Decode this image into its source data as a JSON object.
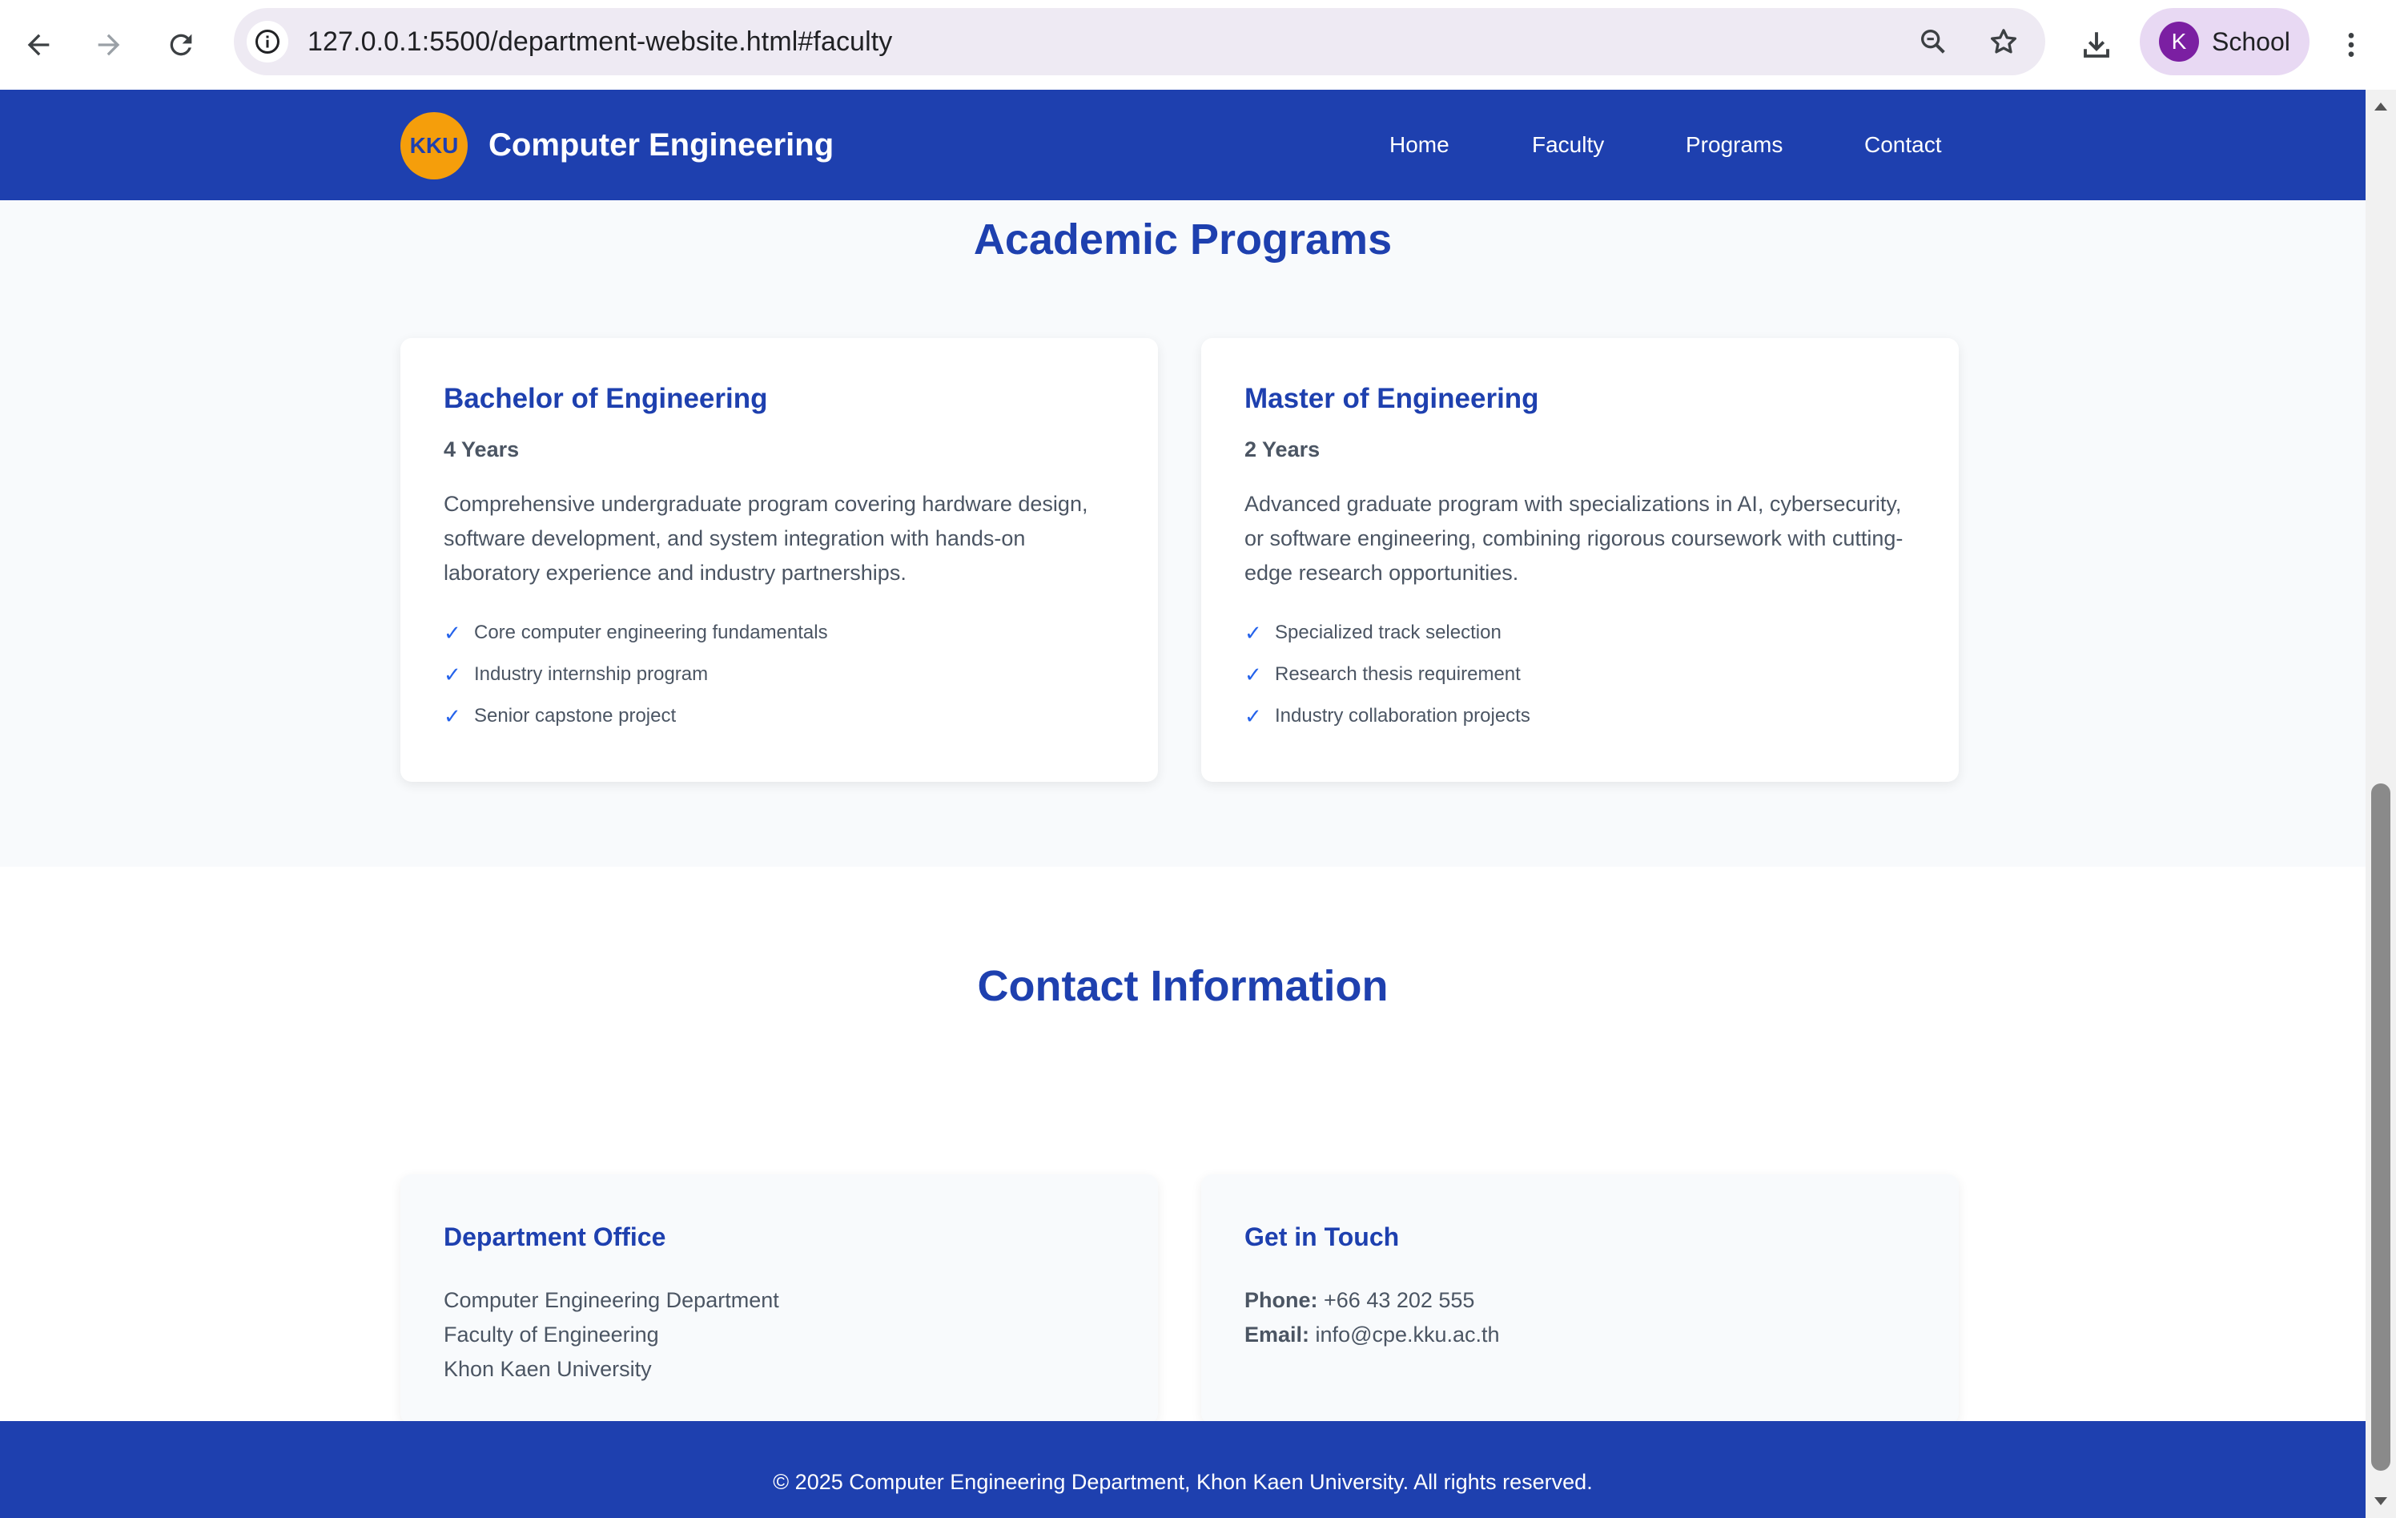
{
  "browser": {
    "url": "127.0.0.1:5500/department-website.html#faculty",
    "profile_initial": "K",
    "profile_name": "School"
  },
  "site": {
    "logo_text": "KKU",
    "title": "Computer Engineering",
    "nav": [
      "Home",
      "Faculty",
      "Programs",
      "Contact"
    ]
  },
  "programs": {
    "title": "Academic Programs",
    "cards": [
      {
        "title": "Bachelor of Engineering",
        "duration": "4 Years",
        "description": "Comprehensive undergraduate program covering hardware design, software development, and system integration with hands-on laboratory experience and industry partnerships.",
        "features": [
          "Core computer engineering fundamentals",
          "Industry internship program",
          "Senior capstone project"
        ]
      },
      {
        "title": "Master of Engineering",
        "duration": "2 Years",
        "description": "Advanced graduate program with specializations in AI, cybersecurity, or software engineering, combining rigorous coursework with cutting-edge research opportunities.",
        "features": [
          "Specialized track selection",
          "Research thesis requirement",
          "Industry collaboration projects"
        ]
      }
    ]
  },
  "contact": {
    "title": "Contact Information",
    "office": {
      "title": "Department Office",
      "lines": [
        "Computer Engineering Department",
        "Faculty of Engineering",
        "Khon Kaen University"
      ]
    },
    "touch": {
      "title": "Get in Touch",
      "phone_label": "Phone:",
      "phone": "+66 43 202 555",
      "email_label": "Email:",
      "email": "info@cpe.kku.ac.th"
    }
  },
  "footer": {
    "text": "© 2025 Computer Engineering Department, Khon Kaen University. All rights reserved."
  },
  "colors": {
    "primary": "#1e40af",
    "accent": "#f59e0b",
    "check": "#2563eb"
  },
  "icons": [
    "back-arrow-icon",
    "forward-arrow-icon",
    "reload-icon",
    "site-info-icon",
    "zoom-icon",
    "bookmark-star-icon",
    "download-icon",
    "menu-kebab-icon"
  ]
}
